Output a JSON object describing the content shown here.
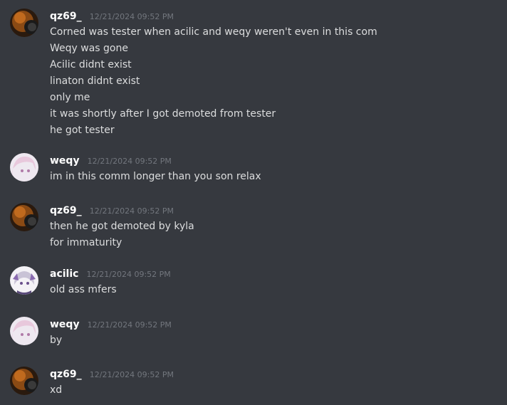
{
  "messages": [
    {
      "username": "qz69_",
      "timestamp": "12/21/2024 09:52 PM",
      "avatar": "qz69-avatar",
      "lines": [
        "Corned was tester when acilic and weqy weren't even in this com",
        "Weqy was gone",
        "Acilic didnt exist",
        "linaton didnt exist",
        "only me",
        "it was shortly after I got demoted from tester",
        "he got tester"
      ]
    },
    {
      "username": "weqy",
      "timestamp": "12/21/2024 09:52 PM",
      "avatar": "weqy-avatar",
      "lines": [
        "im in this comm longer than you son relax"
      ]
    },
    {
      "username": "qz69_",
      "timestamp": "12/21/2024 09:52 PM",
      "avatar": "qz69-avatar",
      "lines": [
        "then he got demoted by kyla",
        "for immaturity"
      ]
    },
    {
      "username": "acilic",
      "timestamp": "12/21/2024 09:52 PM",
      "avatar": "acilic-avatar",
      "lines": [
        "old ass mfers"
      ]
    },
    {
      "username": "weqy",
      "timestamp": "12/21/2024 09:52 PM",
      "avatar": "weqy-avatar",
      "lines": [
        "by"
      ]
    },
    {
      "username": "qz69_",
      "timestamp": "12/21/2024 09:52 PM",
      "avatar": "qz69-avatar",
      "lines": [
        "xd"
      ]
    }
  ]
}
